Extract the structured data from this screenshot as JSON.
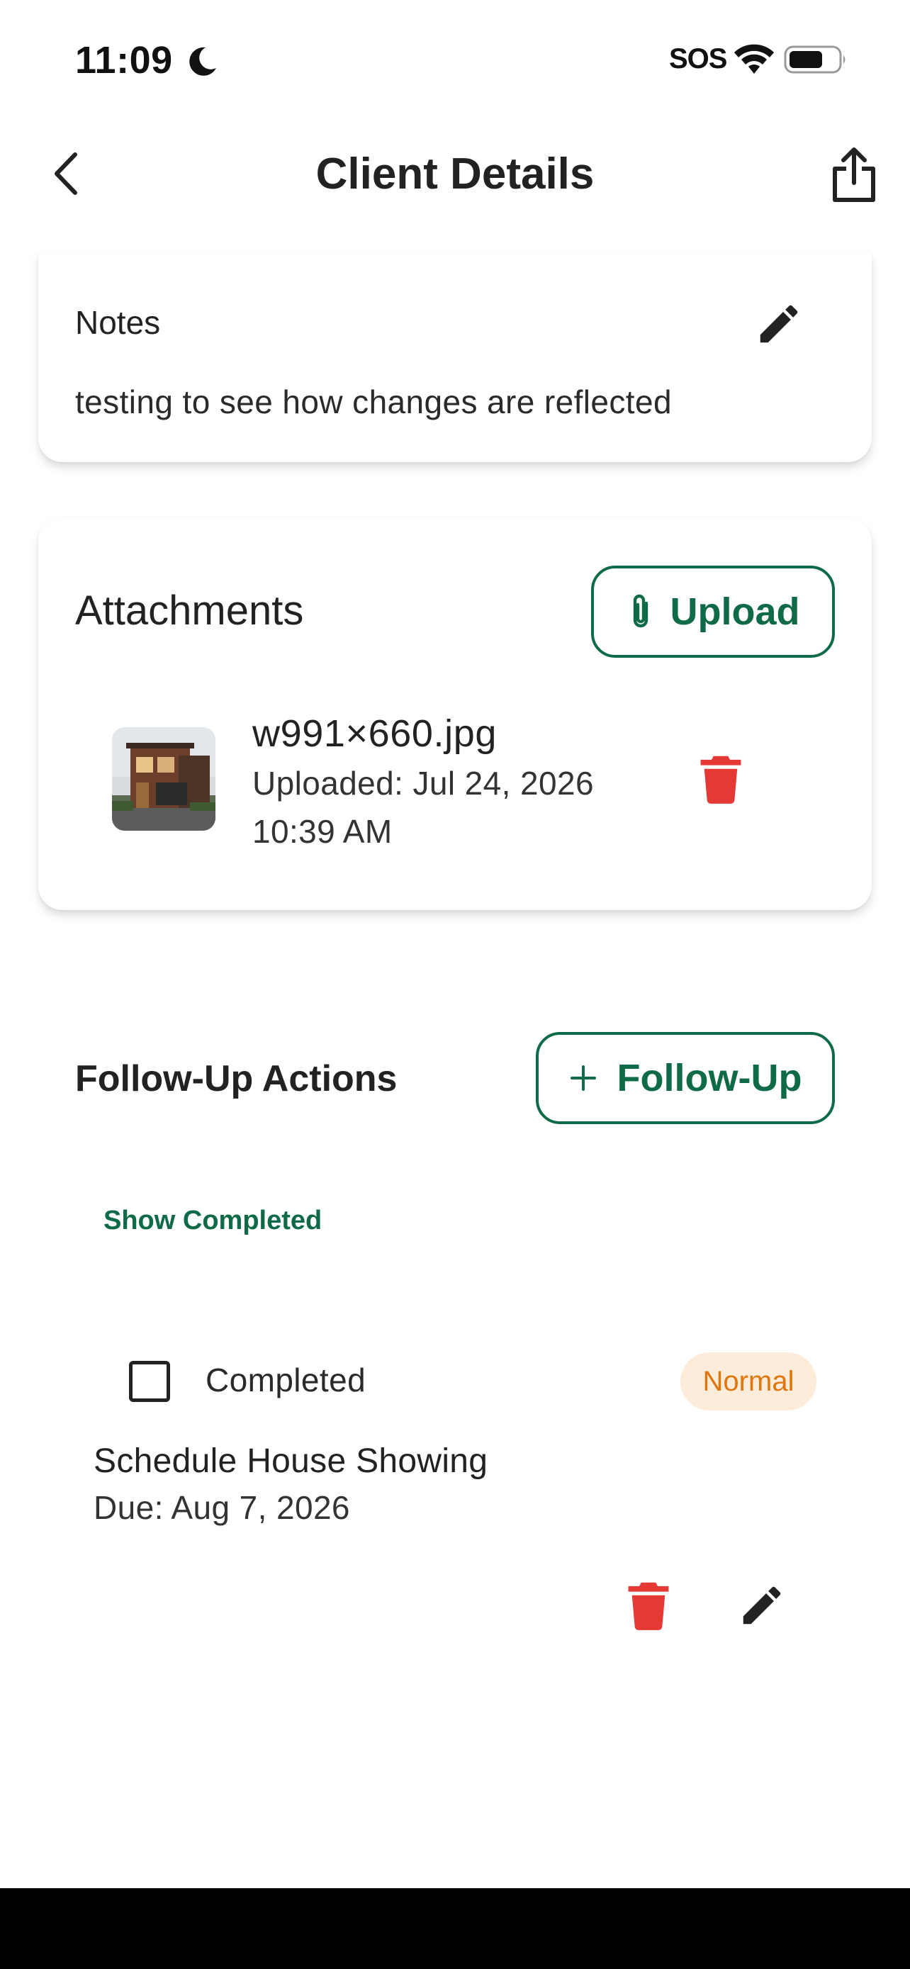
{
  "status_bar": {
    "time": "11:09",
    "focus_icon": "moon-icon",
    "carrier": "SOS",
    "wifi_icon": "wifi-icon",
    "battery_icon": "battery-icon"
  },
  "nav": {
    "title": "Client Details",
    "back_icon": "chevron-left-icon",
    "share_icon": "share-icon"
  },
  "notes": {
    "title": "Notes",
    "text": "testing to see how changes are reflected",
    "edit_icon": "pencil-icon"
  },
  "attachments": {
    "title": "Attachments",
    "upload_label": "Upload",
    "upload_icon": "paperclip-icon",
    "files": [
      {
        "name": "w991×660.jpg",
        "uploaded": "Uploaded: Jul 24, 2026",
        "time": "10:39 AM",
        "delete_icon": "trash-icon"
      }
    ]
  },
  "follow_up": {
    "title": "Follow-Up Actions",
    "add_label": "Follow-Up",
    "add_icon": "plus-icon",
    "show_completed": "Show Completed",
    "items": [
      {
        "completed_label": "Completed",
        "priority": "Normal",
        "title": "Schedule House Showing",
        "due": "Due: Aug 7, 2026"
      }
    ]
  },
  "colors": {
    "accent": "#0f6b47",
    "danger": "#e53935",
    "priority_text": "#e0760e",
    "priority_bg": "#fdecd9"
  }
}
